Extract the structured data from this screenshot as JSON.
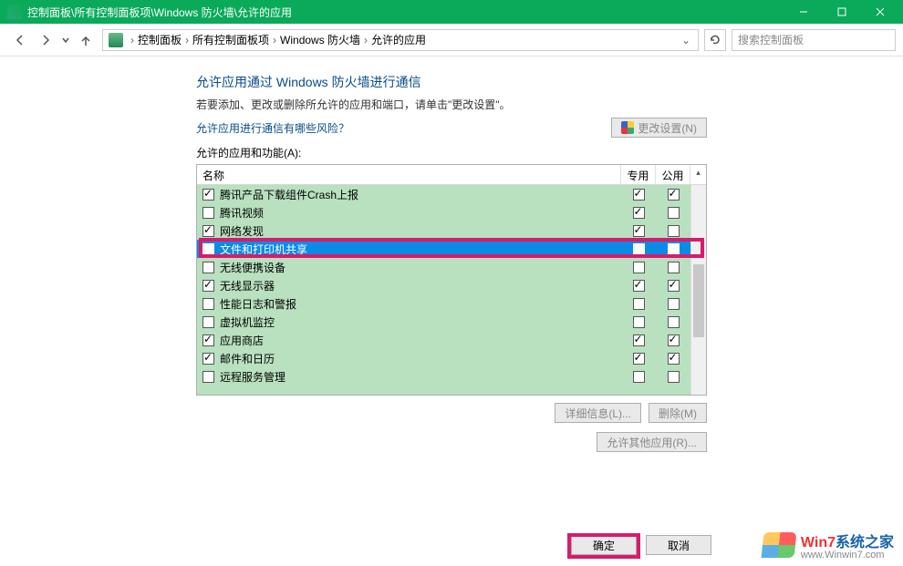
{
  "titlebar": {
    "title": "控制面板\\所有控制面板项\\Windows 防火墙\\允许的应用"
  },
  "breadcrumb": {
    "items": [
      "控制面板",
      "所有控制面板项",
      "Windows 防火墙",
      "允许的应用"
    ]
  },
  "search": {
    "placeholder": "搜索控制面板"
  },
  "heading": "允许应用通过 Windows 防火墙进行通信",
  "subtext": "若要添加、更改或删除所允许的应用和端口，请单击\"更改设置\"。",
  "risk_link": "允许应用进行通信有哪些风险？",
  "change_settings": "更改设置(N)",
  "list_label": "允许的应用和功能(A):",
  "columns": {
    "name": "名称",
    "private": "专用",
    "public": "公用"
  },
  "apps": [
    {
      "enabled": true,
      "name": "腾讯产品下载组件Crash上报",
      "private": true,
      "public": true,
      "selected": false
    },
    {
      "enabled": false,
      "name": "腾讯视频",
      "private": true,
      "public": false,
      "selected": false
    },
    {
      "enabled": true,
      "name": "网络发现",
      "private": true,
      "public": false,
      "selected": false
    },
    {
      "enabled": true,
      "name": "文件和打印机共享",
      "private": true,
      "public": false,
      "selected": true
    },
    {
      "enabled": false,
      "name": "无线便携设备",
      "private": false,
      "public": false,
      "selected": false
    },
    {
      "enabled": true,
      "name": "无线显示器",
      "private": true,
      "public": true,
      "selected": false
    },
    {
      "enabled": false,
      "name": "性能日志和警报",
      "private": false,
      "public": false,
      "selected": false
    },
    {
      "enabled": false,
      "name": "虚拟机监控",
      "private": false,
      "public": false,
      "selected": false
    },
    {
      "enabled": true,
      "name": "应用商店",
      "private": true,
      "public": true,
      "selected": false
    },
    {
      "enabled": true,
      "name": "邮件和日历",
      "private": true,
      "public": true,
      "selected": false
    },
    {
      "enabled": false,
      "name": "远程服务管理",
      "private": false,
      "public": false,
      "selected": false
    }
  ],
  "buttons": {
    "details": "详细信息(L)...",
    "remove": "删除(M)",
    "allow_other": "允许其他应用(R)...",
    "ok": "确定",
    "cancel": "取消"
  },
  "watermark": {
    "line1a": "Win7",
    "line1b": "系统之家",
    "line2": "www.Winwin7.com"
  }
}
